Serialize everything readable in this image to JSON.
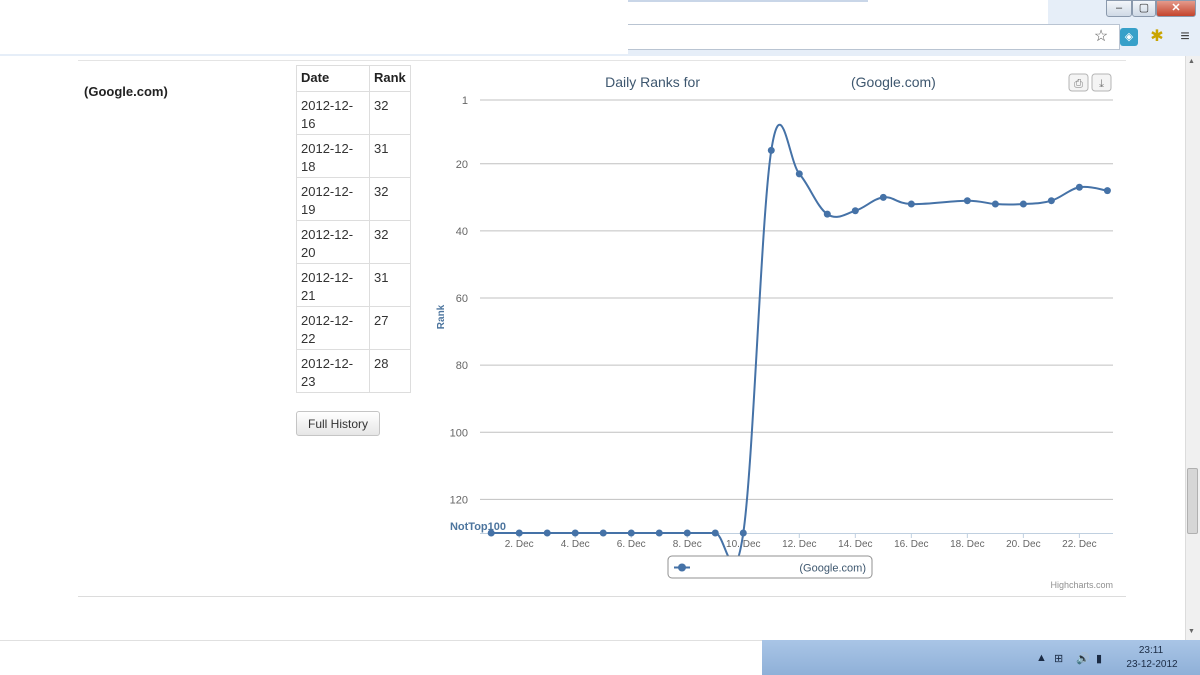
{
  "window": {
    "minimize_glyph": "–",
    "maximize_glyph": "▢",
    "close_glyph": "✕"
  },
  "toolbar": {
    "star_icon": "☆",
    "extension_icon_1": "◈",
    "extension_icon_2": "✱",
    "menu_icon": "≡"
  },
  "page": {
    "site_label": "(Google.com)",
    "table": {
      "headers": [
        "Date",
        "Rank"
      ],
      "rows": [
        {
          "date": "2012-12-16",
          "rank": "32"
        },
        {
          "date": "2012-12-18",
          "rank": "31"
        },
        {
          "date": "2012-12-19",
          "rank": "32"
        },
        {
          "date": "2012-12-20",
          "rank": "32"
        },
        {
          "date": "2012-12-21",
          "rank": "31"
        },
        {
          "date": "2012-12-22",
          "rank": "27"
        },
        {
          "date": "2012-12-23",
          "rank": "28"
        }
      ]
    },
    "full_history_label": "Full History"
  },
  "chart_data": {
    "type": "line",
    "title": "Daily Ranks for",
    "title_suffix": "(Google.com)",
    "ylabel": "Rank",
    "xlabel": "",
    "y_reversed": true,
    "ylim": [
      1,
      130
    ],
    "y_ticks": [
      1,
      20,
      40,
      60,
      80,
      100,
      120
    ],
    "bottom_category_label": "NotTop100",
    "x_ticks": [
      2,
      4,
      6,
      8,
      10,
      12,
      14,
      16,
      18,
      20,
      22
    ],
    "x_tick_labels": [
      "2. Dec",
      "4. Dec",
      "6. Dec",
      "8. Dec",
      "10. Dec",
      "12. Dec",
      "14. Dec",
      "16. Dec",
      "18. Dec",
      "20. Dec",
      "22. Dec"
    ],
    "xlim": [
      0.6,
      23.2
    ],
    "grid": true,
    "legend_position": "bottom-center",
    "credit": "Highcharts.com",
    "accent_color": "#4572a7",
    "series": [
      {
        "name": "(Google.com)",
        "x": [
          1,
          2,
          3,
          4,
          5,
          6,
          7,
          8,
          9,
          10,
          11,
          12,
          13,
          14,
          15,
          16,
          18,
          19,
          20,
          21,
          22,
          23
        ],
        "y": [
          "NotTop100",
          "NotTop100",
          "NotTop100",
          "NotTop100",
          "NotTop100",
          "NotTop100",
          "NotTop100",
          "NotTop100",
          "NotTop100",
          "NotTop100",
          16,
          23,
          35,
          34,
          30,
          32,
          31,
          32,
          32,
          31,
          27,
          28
        ]
      }
    ],
    "print_icon": "⎙",
    "download_icon": "⤓"
  },
  "taskbar": {
    "tray_arrow": "▲",
    "tray_icon_1": "⊞",
    "tray_icon_2": "🔊",
    "tray_icon_3": "▮",
    "time": "23:11",
    "date": "23-12-2012"
  }
}
